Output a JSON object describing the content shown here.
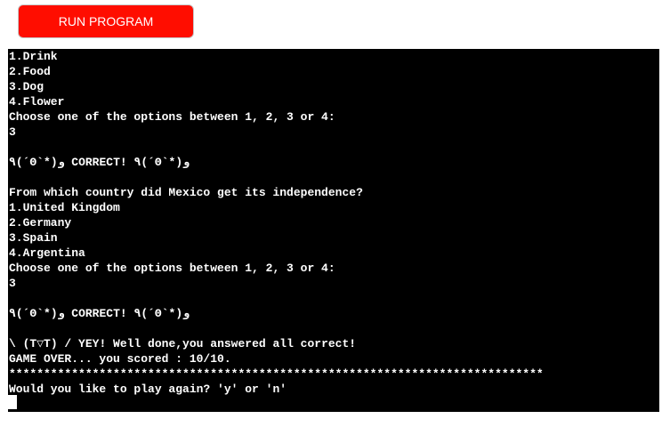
{
  "toolbar": {
    "run_label": "RUN PROGRAM"
  },
  "terminal": {
    "lines": [
      "1.Drink",
      "2.Food",
      "3.Dog",
      "4.Flower",
      "Choose one of the options between 1, 2, 3 or 4:",
      "3",
      "",
      "٩(´ʘ`*)و CORRECT! ٩(´ʘ`*)و",
      "",
      "From which country did Mexico get its independence?",
      "1.United Kingdom",
      "2.Germany",
      "3.Spain",
      "4.Argentina",
      "Choose one of the options between 1, 2, 3 or 4:",
      "3",
      "",
      "٩(´ʘ`*)و CORRECT! ٩(´ʘ`*)و",
      "",
      "\\ (T▽T) / YEY! Well done,you answered all correct!",
      "GAME OVER... you scored : 10/10.",
      "*****************************************************************************",
      "Would you like to play again? 'y' or 'n'"
    ]
  },
  "colors": {
    "run_button_bg": "#ff0d00",
    "terminal_bg": "#000000",
    "terminal_fg": "#ffffff"
  }
}
